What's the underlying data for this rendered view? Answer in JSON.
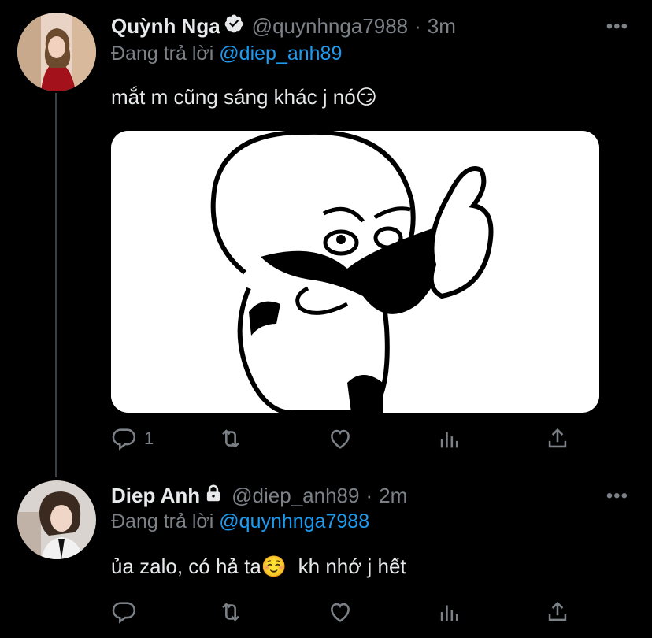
{
  "tweets": [
    {
      "name": "Quỳnh Nga",
      "handle": "@quynhnga7988",
      "separator": "·",
      "time": "3m",
      "verified": true,
      "reply_prefix": "Đang trả lời",
      "reply_mention": "@diep_anh89",
      "text": "mắt m cũng sáng khác j nó",
      "emoji": "😏",
      "more": "•••",
      "actions": {
        "reply_count": "1",
        "retweet_count": "",
        "like_count": ""
      }
    },
    {
      "name": "Diep Anh",
      "handle": "@diep_anh89",
      "separator": "·",
      "time": "2m",
      "locked": true,
      "reply_prefix": "Đang trả lời",
      "reply_mention": "@quynhnga7988",
      "text": "ủa zalo, có hả ta",
      "emoji": "☺️",
      "text_after": "  kh nhớ j hết",
      "more": "•••",
      "actions": {
        "reply_count": "",
        "retweet_count": "",
        "like_count": ""
      }
    }
  ],
  "colors": {
    "background": "#000000",
    "text": "#e7e9ea",
    "muted": "#7b8187",
    "link": "#1d9bf0"
  }
}
